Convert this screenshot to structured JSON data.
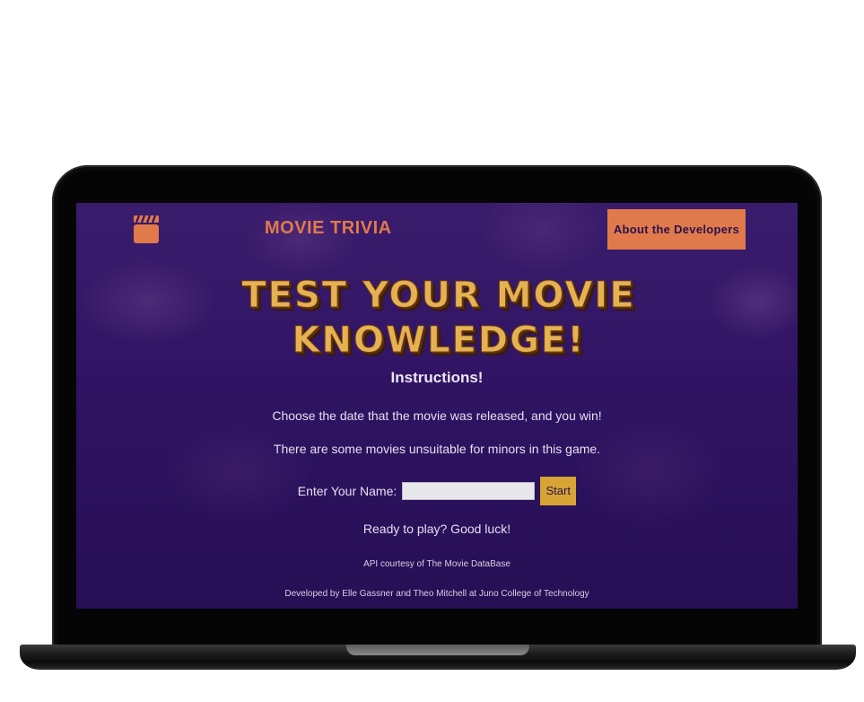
{
  "header": {
    "icon": "clapperboard-icon",
    "brand": "MOVIE TRIVIA",
    "about_button": "About the Developers"
  },
  "hero": {
    "title": "TEST YOUR MOVIE KNOWLEDGE!"
  },
  "instructions": {
    "heading": "Instructions!",
    "line1": "Choose the date that the movie was released, and you win!",
    "line2": "There are some movies unsuitable for minors in this game."
  },
  "form": {
    "name_label": "Enter Your Name:",
    "name_value": "",
    "start_button": "Start"
  },
  "ready_text": "Ready to play? Good luck!",
  "footer": {
    "api_credit": "API courtesy of The Movie DataBase",
    "developers": "Developed by Elle Gassner and Theo Mitchell at Juno College of Technology"
  },
  "colors": {
    "accent_orange": "#e07a4a",
    "title_gold": "#e4b253",
    "button_gold": "#d6a334",
    "background_purple": "#301463"
  }
}
